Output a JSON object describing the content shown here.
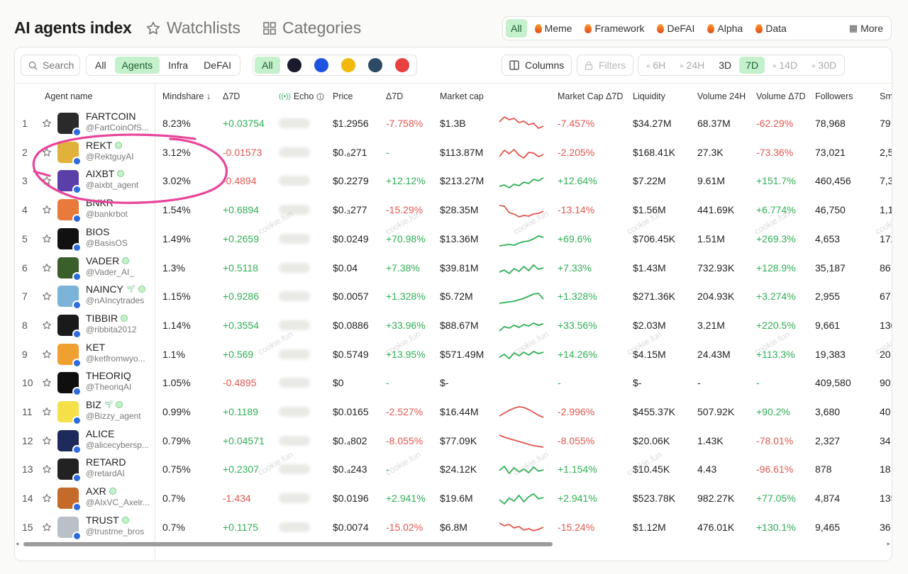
{
  "header": {
    "title": "AI agents index",
    "watchlists_label": "Watchlists",
    "categories_label": "Categories",
    "category_pills": [
      {
        "label": "All",
        "active": true,
        "icon": ""
      },
      {
        "label": "Meme",
        "active": false,
        "icon": "flame-icon"
      },
      {
        "label": "Framework",
        "active": false,
        "icon": "flame-icon"
      },
      {
        "label": "DeFAI",
        "active": false,
        "icon": "flame-icon"
      },
      {
        "label": "Alpha",
        "active": false,
        "icon": "flame-icon"
      },
      {
        "label": "Data",
        "active": false,
        "icon": "flame-icon"
      },
      {
        "label": "More",
        "active": false,
        "icon": "grid-icon"
      }
    ]
  },
  "toolbar": {
    "search_placeholder": "Search",
    "type_tabs": [
      "All",
      "Agents",
      "Infra",
      "DeFAI"
    ],
    "type_active": "Agents",
    "chain_all_label": "All",
    "chains": [
      {
        "name": "solana",
        "color": "#1b1b2e"
      },
      {
        "name": "base",
        "color": "#1f54e0"
      },
      {
        "name": "bnb",
        "color": "#f0b90b"
      },
      {
        "name": "chain-4",
        "color": "#2c4a66"
      },
      {
        "name": "avalanche",
        "color": "#e84142"
      }
    ],
    "columns_label": "Columns",
    "filters_label": "Filters",
    "timeframes": [
      {
        "label": "6H",
        "locked": true
      },
      {
        "label": "24H",
        "locked": true
      },
      {
        "label": "3D",
        "locked": false
      },
      {
        "label": "7D",
        "locked": false,
        "active": true
      },
      {
        "label": "14D",
        "locked": true
      },
      {
        "label": "30D",
        "locked": true
      }
    ]
  },
  "columns": {
    "agent": "Agent name",
    "mindshare": "Mindshare",
    "d7": "Δ7D",
    "echo": "Echo",
    "price": "Price",
    "price_d7": "Δ7D",
    "mcap": "Market cap",
    "mcap_d7": "Market Cap Δ7D",
    "liquidity": "Liquidity",
    "volume": "Volume 24H",
    "volume_d7": "Volume Δ7D",
    "followers": "Followers",
    "smart": "Sm"
  },
  "watermark_text": "cookie.fun",
  "rows": [
    {
      "rank": "1",
      "name": "FARTCOIN",
      "handle": "@FartCoinOfS...",
      "avatar": "#2a2a2a",
      "verified": false,
      "plant": false,
      "mindshare": "8.23%",
      "d7": "+0.03754",
      "d7_sign": "pos",
      "price": "$1.2956",
      "price_d7": "-7.758%",
      "price_d7_sign": "neg",
      "mcap": "$1.3B",
      "spark": [
        10,
        3,
        7,
        5,
        11,
        9,
        14,
        12,
        19,
        16
      ],
      "spark_color": "#e0574f",
      "mcap_d7": "-7.457%",
      "mcap_d7_sign": "neg",
      "liquidity": "$34.27M",
      "volume": "68.37M",
      "volume_d7": "-62.29%",
      "volume_d7_sign": "neg",
      "followers": "78,968",
      "smart": "79"
    },
    {
      "rank": "2",
      "name": "REKT",
      "handle": "@RektguyAI",
      "avatar": "#e0b13b",
      "verified": true,
      "plant": false,
      "mindshare": "3.12%",
      "d7": "-0.01573",
      "d7_sign": "neg",
      "price": "$0.₆271",
      "price_d7": "-",
      "price_d7_sign": "pos",
      "mcap": "$113.87M",
      "spark": [
        18,
        9,
        14,
        8,
        16,
        20,
        12,
        13,
        18,
        15
      ],
      "spark_color": "#e0574f",
      "mcap_d7": "-2.205%",
      "mcap_d7_sign": "neg",
      "liquidity": "$168.41K",
      "volume": "27.3K",
      "volume_d7": "-73.36%",
      "volume_d7_sign": "neg",
      "followers": "73,021",
      "smart": "2,5"
    },
    {
      "rank": "3",
      "name": "AIXBT",
      "handle": "@aixbt_agent",
      "avatar": "#5a3fa8",
      "verified": true,
      "plant": false,
      "mindshare": "3.02%",
      "d7": "-0.4894",
      "d7_sign": "neg",
      "price": "$0.2279",
      "price_d7": "+12.12%",
      "price_d7_sign": "pos",
      "mcap": "$213.27M",
      "spark": [
        20,
        18,
        22,
        17,
        19,
        14,
        16,
        10,
        12,
        8
      ],
      "spark_color": "#2fae55",
      "mcap_d7": "+12.64%",
      "mcap_d7_sign": "pos",
      "liquidity": "$7.22M",
      "volume": "9.61M",
      "volume_d7": "+151.7%",
      "volume_d7_sign": "pos",
      "followers": "460,456",
      "smart": "7,3"
    },
    {
      "rank": "4",
      "name": "BNKR",
      "handle": "@bankrbot",
      "avatar": "#e87a3c",
      "verified": false,
      "plant": false,
      "mindshare": "1.54%",
      "d7": "+0.6894",
      "d7_sign": "pos",
      "price": "$0.₃277",
      "price_d7": "-15.29%",
      "price_d7_sign": "neg",
      "mcap": "$28.35M",
      "spark": [
        6,
        7,
        16,
        18,
        22,
        20,
        21,
        18,
        17,
        14
      ],
      "spark_color": "#e0574f",
      "mcap_d7": "-13.14%",
      "mcap_d7_sign": "neg",
      "liquidity": "$1.56M",
      "volume": "441.69K",
      "volume_d7": "+6.774%",
      "volume_d7_sign": "pos",
      "followers": "46,750",
      "smart": "1,1"
    },
    {
      "rank": "5",
      "name": "BIOS",
      "handle": "@BasisOS",
      "avatar": "#111111",
      "verified": false,
      "plant": false,
      "mindshare": "1.49%",
      "d7": "+0.2659",
      "d7_sign": "pos",
      "price": "$0.0249",
      "price_d7": "+70.98%",
      "price_d7_sign": "pos",
      "mcap": "$13.36M",
      "spark": [
        22,
        21,
        20,
        21,
        18,
        16,
        15,
        12,
        8,
        10
      ],
      "spark_color": "#2fae55",
      "mcap_d7": "+69.6%",
      "mcap_d7_sign": "pos",
      "liquidity": "$706.45K",
      "volume": "1.51M",
      "volume_d7": "+269.3%",
      "volume_d7_sign": "pos",
      "followers": "4,653",
      "smart": "172"
    },
    {
      "rank": "6",
      "name": "VADER",
      "handle": "@Vader_AI_",
      "avatar": "#3b5f2a",
      "verified": true,
      "plant": false,
      "mindshare": "1.3%",
      "d7": "+0.5118",
      "d7_sign": "pos",
      "price": "$0.04",
      "price_d7": "+7.38%",
      "price_d7_sign": "pos",
      "mcap": "$39.81M",
      "spark": [
        18,
        15,
        20,
        13,
        17,
        10,
        16,
        8,
        14,
        12
      ],
      "spark_color": "#2fae55",
      "mcap_d7": "+7.33%",
      "mcap_d7_sign": "pos",
      "liquidity": "$1.43M",
      "volume": "732.93K",
      "volume_d7": "+128.9%",
      "volume_d7_sign": "pos",
      "followers": "35,187",
      "smart": "86"
    },
    {
      "rank": "7",
      "name": "NAINCY",
      "handle": "@nAIncytrades",
      "avatar": "#7bb3d9",
      "verified": true,
      "plant": true,
      "mindshare": "1.15%",
      "d7": "+0.9286",
      "d7_sign": "pos",
      "price": "$0.0057",
      "price_d7": "+1.328%",
      "price_d7_sign": "pos",
      "mcap": "$5.72M",
      "spark": [
        22,
        21,
        20,
        19,
        17,
        15,
        12,
        9,
        8,
        16
      ],
      "spark_color": "#2fae55",
      "mcap_d7": "+1.328%",
      "mcap_d7_sign": "pos",
      "liquidity": "$271.36K",
      "volume": "204.93K",
      "volume_d7": "+3.274%",
      "volume_d7_sign": "pos",
      "followers": "2,955",
      "smart": "67"
    },
    {
      "rank": "8",
      "name": "TIBBIR",
      "handle": "@ribbita2012",
      "avatar": "#1a1a1a",
      "verified": true,
      "plant": false,
      "mindshare": "1.14%",
      "d7": "+0.3554",
      "d7_sign": "pos",
      "price": "$0.0886",
      "price_d7": "+33.96%",
      "price_d7_sign": "pos",
      "mcap": "$88.67M",
      "spark": [
        20,
        14,
        16,
        12,
        15,
        11,
        13,
        9,
        12,
        10
      ],
      "spark_color": "#2fae55",
      "mcap_d7": "+33.56%",
      "mcap_d7_sign": "pos",
      "liquidity": "$2.03M",
      "volume": "3.21M",
      "volume_d7": "+220.5%",
      "volume_d7_sign": "pos",
      "followers": "9,661",
      "smart": "130"
    },
    {
      "rank": "9",
      "name": "KET",
      "handle": "@ketfromwyo...",
      "avatar": "#f0a030",
      "verified": false,
      "plant": false,
      "mindshare": "1.1%",
      "d7": "+0.569",
      "d7_sign": "pos",
      "price": "$0.5749",
      "price_d7": "+13.95%",
      "price_d7_sign": "pos",
      "mcap": "$571.49M",
      "spark": [
        16,
        12,
        18,
        10,
        14,
        9,
        13,
        8,
        11,
        9
      ],
      "spark_color": "#2fae55",
      "mcap_d7": "+14.26%",
      "mcap_d7_sign": "pos",
      "liquidity": "$4.15M",
      "volume": "24.43M",
      "volume_d7": "+113.3%",
      "volume_d7_sign": "pos",
      "followers": "19,383",
      "smart": "20"
    },
    {
      "rank": "10",
      "name": "THEORIQ",
      "handle": "@TheoriqAI",
      "avatar": "#0f0f0f",
      "verified": false,
      "plant": false,
      "mindshare": "1.05%",
      "d7": "-0.4895",
      "d7_sign": "neg",
      "price": "$0",
      "price_d7": "-",
      "price_d7_sign": "pos",
      "mcap": "$-",
      "spark": [],
      "spark_color": "#2fae55",
      "mcap_d7": "-",
      "mcap_d7_sign": "pos",
      "liquidity": "$-",
      "volume": "-",
      "volume_d7": "-",
      "volume_d7_sign": "pos",
      "followers": "409,580",
      "smart": "90"
    },
    {
      "rank": "11",
      "name": "BIZ",
      "handle": "@Bizzy_agent",
      "avatar": "#f6e04a",
      "verified": true,
      "plant": true,
      "mindshare": "0.99%",
      "d7": "+0.1189",
      "d7_sign": "pos",
      "price": "$0.0165",
      "price_d7": "-2.527%",
      "price_d7_sign": "neg",
      "mcap": "$16.44M",
      "spark": [
        18,
        14,
        10,
        7,
        5,
        6,
        9,
        13,
        17,
        20
      ],
      "spark_color": "#e0574f",
      "mcap_d7": "-2.996%",
      "mcap_d7_sign": "neg",
      "liquidity": "$455.37K",
      "volume": "507.92K",
      "volume_d7": "+90.2%",
      "volume_d7_sign": "pos",
      "followers": "3,680",
      "smart": "40"
    },
    {
      "rank": "12",
      "name": "ALICE",
      "handle": "@alicecybersp...",
      "avatar": "#1e2a5c",
      "verified": false,
      "plant": false,
      "mindshare": "0.79%",
      "d7": "+0.04571",
      "d7_sign": "pos",
      "price": "$0.₄802",
      "price_d7": "-8.055%",
      "price_d7_sign": "neg",
      "mcap": "$77.09K",
      "spark": [
        4,
        7,
        9,
        11,
        13,
        15,
        17,
        19,
        20,
        21
      ],
      "spark_color": "#e0574f",
      "mcap_d7": "-8.055%",
      "mcap_d7_sign": "neg",
      "liquidity": "$20.06K",
      "volume": "1.43K",
      "volume_d7": "-78.01%",
      "volume_d7_sign": "neg",
      "followers": "2,327",
      "smart": "34"
    },
    {
      "rank": "13",
      "name": "RETARD",
      "handle": "@retardAI",
      "avatar": "#222222",
      "verified": false,
      "plant": false,
      "mindshare": "0.75%",
      "d7": "+0.2307",
      "d7_sign": "pos",
      "price": "$0.₄243",
      "price_d7": "-",
      "price_d7_sign": "pos",
      "mcap": "$24.12K",
      "spark": [
        14,
        8,
        18,
        10,
        16,
        12,
        17,
        9,
        15,
        13
      ],
      "spark_color": "#2fae55",
      "mcap_d7": "+1.154%",
      "mcap_d7_sign": "pos",
      "liquidity": "$10.45K",
      "volume": "4.43",
      "volume_d7": "-96.61%",
      "volume_d7_sign": "neg",
      "followers": "878",
      "smart": "18"
    },
    {
      "rank": "14",
      "name": "AXR",
      "handle": "@AIxVC_Axelr...",
      "avatar": "#c46a2a",
      "verified": true,
      "plant": false,
      "mindshare": "0.7%",
      "d7": "-1.434",
      "d7_sign": "neg",
      "price": "$0.0196",
      "price_d7": "+2.941%",
      "price_d7_sign": "pos",
      "mcap": "$19.6M",
      "spark": [
        14,
        20,
        12,
        16,
        8,
        17,
        10,
        6,
        13,
        11
      ],
      "spark_color": "#2fae55",
      "mcap_d7": "+2.941%",
      "mcap_d7_sign": "pos",
      "liquidity": "$523.78K",
      "volume": "982.27K",
      "volume_d7": "+77.05%",
      "volume_d7_sign": "pos",
      "followers": "4,874",
      "smart": "135"
    },
    {
      "rank": "15",
      "name": "TRUST",
      "handle": "@trustme_bros",
      "avatar": "#b9c0c7",
      "verified": true,
      "plant": false,
      "mindshare": "0.7%",
      "d7": "+0.1175",
      "d7_sign": "pos",
      "price": "$0.0074",
      "price_d7": "-15.02%",
      "price_d7_sign": "neg",
      "mcap": "$6.8M",
      "spark": [
        6,
        10,
        8,
        13,
        11,
        16,
        14,
        17,
        15,
        12
      ],
      "spark_color": "#e0574f",
      "mcap_d7": "-15.24%",
      "mcap_d7_sign": "neg",
      "liquidity": "$1.12M",
      "volume": "476.01K",
      "volume_d7": "+130.1%",
      "volume_d7_sign": "pos",
      "followers": "9,465",
      "smart": "36"
    }
  ]
}
